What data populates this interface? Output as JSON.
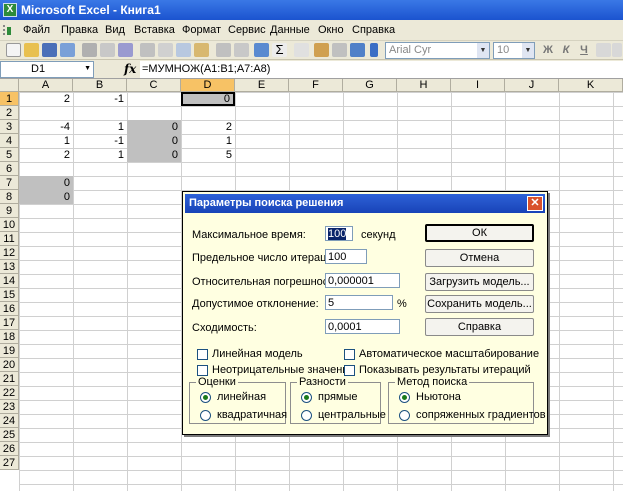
{
  "window": {
    "title": "Microsoft Excel - Книга1",
    "app_icon": "X"
  },
  "menu": [
    "Файл",
    "Правка",
    "Вид",
    "Вставка",
    "Формат",
    "Сервис",
    "Данные",
    "Окно",
    "Справка"
  ],
  "toolbar": {
    "font_name": "Arial Cyr",
    "font_size": "10",
    "bold": "Ж",
    "italic": "К",
    "underline": "Ч"
  },
  "formula_bar": {
    "name_box": "D1",
    "fx_label": "fx",
    "formula": "=МУМНОЖ(A1:B1;A7:A8)"
  },
  "sheet": {
    "columns": [
      "A",
      "B",
      "C",
      "D",
      "E",
      "F",
      "G",
      "H",
      "I",
      "J",
      "K"
    ],
    "rows": [
      "1",
      "2",
      "3",
      "4",
      "5",
      "6",
      "7",
      "8",
      "9",
      "10",
      "11",
      "12",
      "13",
      "14",
      "15",
      "16",
      "17",
      "18",
      "19",
      "20",
      "21",
      "22",
      "23",
      "24",
      "25",
      "26",
      "27"
    ],
    "cells": {
      "A1": "2",
      "B1": "-1",
      "D1": "0",
      "A3": "-4",
      "B3": "1",
      "C3": "0",
      "D3": "2",
      "A4": "1",
      "B4": "-1",
      "C4": "0",
      "D4": "1",
      "A5": "2",
      "B5": "1",
      "C5": "0",
      "D5": "5",
      "A7": "0",
      "A8": "0"
    }
  },
  "dialog": {
    "title": "Параметры поиска решения",
    "max_time_label": "Максимальное время:",
    "max_time_value": "100",
    "max_time_unit": "секунд",
    "iterations_label": "Предельное число итераций:",
    "iterations_value": "100",
    "precision_label": "Относительная погрешность:",
    "precision_value": "0,000001",
    "tolerance_label": "Допустимое отклонение:",
    "tolerance_value": "5",
    "tolerance_unit": "%",
    "convergence_label": "Сходимость:",
    "convergence_value": "0,0001",
    "buttons": {
      "ok": "ОК",
      "cancel": "Отмена",
      "load": "Загрузить модель...",
      "save": "Сохранить модель...",
      "help": "Справка"
    },
    "checkboxes": {
      "linear": "Линейная модель",
      "auto_scale": "Автоматическое масштабирование",
      "nonneg": "Неотрицательные значения",
      "show_iter": "Показывать результаты итераций"
    },
    "estimates": {
      "legend": "Оценки",
      "opt1": "линейная",
      "opt2": "квадратичная",
      "selected": "линейная"
    },
    "derivatives": {
      "legend": "Разности",
      "opt1": "прямые",
      "opt2": "центральные",
      "selected": "прямые"
    },
    "search": {
      "legend": "Метод поиска",
      "opt1": "Ньютона",
      "opt2": "сопряженных градиентов",
      "selected": "Ньютона"
    }
  }
}
